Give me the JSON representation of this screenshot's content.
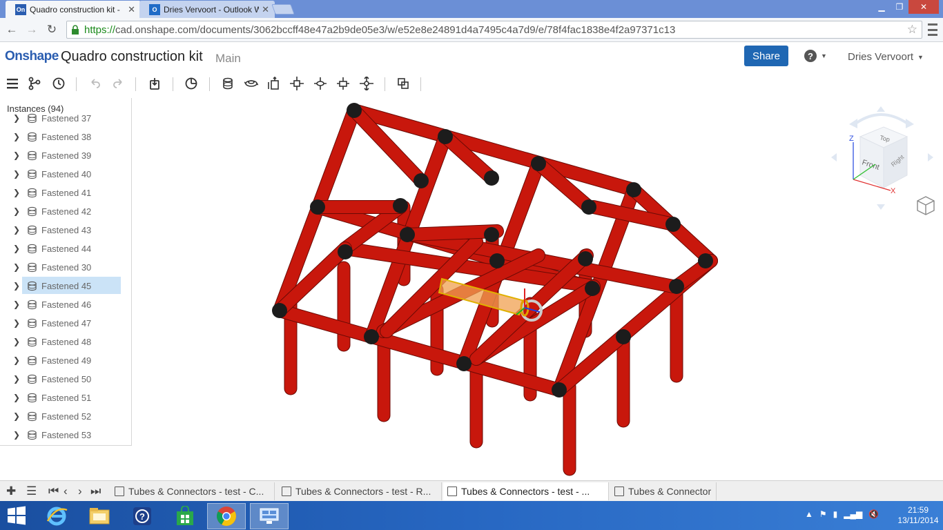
{
  "browser": {
    "tabs": [
      {
        "title": "Quadro construction kit -",
        "favicon_text": "On",
        "favicon_color": "#2a5db0",
        "active": true
      },
      {
        "title": "Dries Vervoort - Outlook W",
        "favicon_text": "O",
        "favicon_color": "#1f6bc7",
        "active": false
      }
    ],
    "url_scheme": "https://",
    "url_rest": "cad.onshape.com/documents/3062bccff48e47a2b9de05e3/w/e52e8e24891d4a7495c4a7d9/e/78f4fac1838e4f2a97371c13"
  },
  "header": {
    "logo": "Onshape",
    "document_title": "Quadro construction kit",
    "branch": "Main",
    "share_label": "Share",
    "user_name": "Dries Vervoort"
  },
  "toolbar": {
    "icons": [
      "menu-icon",
      "feature-tree-icon",
      "history-icon",
      "undo-icon",
      "redo-icon",
      "insert-icon",
      "mate-connector-icon",
      "fastened-mate-icon",
      "revolute-mate-icon",
      "slider-mate-icon",
      "planar-mate-icon",
      "cylindrical-mate-icon",
      "ball-mate-icon",
      "explode-icon"
    ]
  },
  "instances": {
    "title": "Instances (94)",
    "items": [
      {
        "label": "Fastened 37",
        "selected": false
      },
      {
        "label": "Fastened 38",
        "selected": false
      },
      {
        "label": "Fastened 39",
        "selected": false
      },
      {
        "label": "Fastened 40",
        "selected": false
      },
      {
        "label": "Fastened 41",
        "selected": false
      },
      {
        "label": "Fastened 42",
        "selected": false
      },
      {
        "label": "Fastened 43",
        "selected": false
      },
      {
        "label": "Fastened 44",
        "selected": false
      },
      {
        "label": "Fastened 30",
        "selected": false
      },
      {
        "label": "Fastened 45",
        "selected": true
      },
      {
        "label": "Fastened 46",
        "selected": false
      },
      {
        "label": "Fastened 47",
        "selected": false
      },
      {
        "label": "Fastened 48",
        "selected": false
      },
      {
        "label": "Fastened 49",
        "selected": false
      },
      {
        "label": "Fastened 50",
        "selected": false
      },
      {
        "label": "Fastened 51",
        "selected": false
      },
      {
        "label": "Fastened 52",
        "selected": false
      },
      {
        "label": "Fastened 53",
        "selected": false
      }
    ]
  },
  "viewcube": {
    "top": "Top",
    "front": "Front",
    "right": "Right",
    "axis_x": "X",
    "axis_z": "Z"
  },
  "doc_tabs": [
    {
      "label": "Tubes & Connectors - test - C...",
      "active": false
    },
    {
      "label": "Tubes & Connectors - test - R...",
      "active": false
    },
    {
      "label": "Tubes & Connectors - test - ...",
      "active": true
    },
    {
      "label": "Tubes & Connector",
      "active": false
    }
  ],
  "taskbar": {
    "time": "21:59",
    "date": "13/11/2014"
  },
  "colors": {
    "tube_red": "#c8170c",
    "connector_black": "#1c1c1c",
    "selection_orange": "#f0a050",
    "accent_blue": "#1f67b3"
  }
}
